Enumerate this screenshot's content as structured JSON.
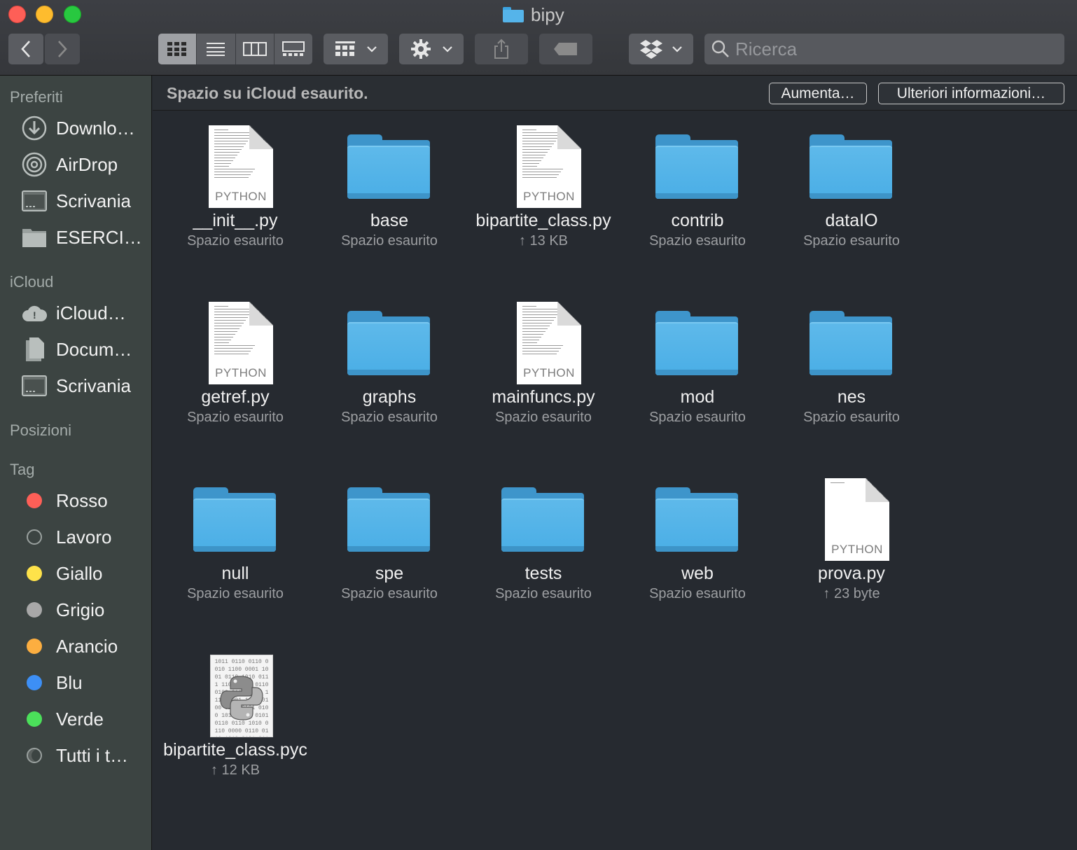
{
  "window": {
    "title": "bipy"
  },
  "toolbar": {
    "back_label": "‹",
    "forward_label": "›",
    "search_placeholder": "Ricerca"
  },
  "banner": {
    "text": "Spazio su iCloud esaurito.",
    "increase_label": "Aumenta…",
    "more_info_label": "Ulteriori informazioni…"
  },
  "sidebar": {
    "favorites_title": "Preferiti",
    "favorites": [
      {
        "label": "Downlo…",
        "icon": "download-icon"
      },
      {
        "label": "AirDrop",
        "icon": "airdrop-icon"
      },
      {
        "label": "Scrivania",
        "icon": "desktop-icon"
      },
      {
        "label": "ESERCI…",
        "icon": "folder-icon"
      }
    ],
    "icloud_title": "iCloud",
    "icloud": [
      {
        "label": "iCloud…",
        "icon": "cloud-icon"
      },
      {
        "label": "Docum…",
        "icon": "document-icon"
      },
      {
        "label": "Scrivania",
        "icon": "desktop-icon"
      }
    ],
    "locations_title": "Posizioni",
    "tags_title": "Tag",
    "tags": [
      {
        "label": "Rosso",
        "color": "#fe5f57"
      },
      {
        "label": "Lavoro",
        "color": "transparent"
      },
      {
        "label": "Giallo",
        "color": "#fee24a"
      },
      {
        "label": "Grigio",
        "color": "#a8a8a8"
      },
      {
        "label": "Arancio",
        "color": "#fcae40"
      },
      {
        "label": "Blu",
        "color": "#3d8ff5"
      },
      {
        "label": "Verde",
        "color": "#4be05a"
      },
      {
        "label": "Tutti i t…",
        "color": "multi"
      }
    ]
  },
  "files": [
    {
      "name": "__init__.py",
      "sub": "Spazio esaurito",
      "kind": "python"
    },
    {
      "name": "base",
      "sub": "Spazio esaurito",
      "kind": "folder"
    },
    {
      "name": "bipartite_class.py",
      "sub": "↑ 13 KB",
      "kind": "python"
    },
    {
      "name": "contrib",
      "sub": "Spazio esaurito",
      "kind": "folder"
    },
    {
      "name": "dataIO",
      "sub": "Spazio esaurito",
      "kind": "folder"
    },
    {
      "name": "getref.py",
      "sub": "Spazio esaurito",
      "kind": "python"
    },
    {
      "name": "graphs",
      "sub": "Spazio esaurito",
      "kind": "folder"
    },
    {
      "name": "mainfuncs.py",
      "sub": "Spazio esaurito",
      "kind": "python"
    },
    {
      "name": "mod",
      "sub": "Spazio esaurito",
      "kind": "folder"
    },
    {
      "name": "nes",
      "sub": "Spazio esaurito",
      "kind": "folder"
    },
    {
      "name": "null",
      "sub": "Spazio esaurito",
      "kind": "folder"
    },
    {
      "name": "spe",
      "sub": "Spazio esaurito",
      "kind": "folder"
    },
    {
      "name": "tests",
      "sub": "Spazio esaurito",
      "kind": "folder"
    },
    {
      "name": "web",
      "sub": "Spazio esaurito",
      "kind": "folder"
    },
    {
      "name": "prova.py",
      "sub": "↑ 23 byte",
      "kind": "python"
    },
    {
      "name": "bipartite_class.pyc",
      "sub": "↑ 12 KB",
      "kind": "pyc"
    }
  ],
  "doc_label": "PYTHON",
  "pyc_text": "1011 0110 0110 0010 1100 0001 1001 0110 1010 0111 1100 1101 0110 0100 0110 0101 1110 0001 1001 0100 0110 0101 0100 1010 1011 0101 0110 0110 1010 0110 0000 0110 0110 1010 0101 0110 0001"
}
